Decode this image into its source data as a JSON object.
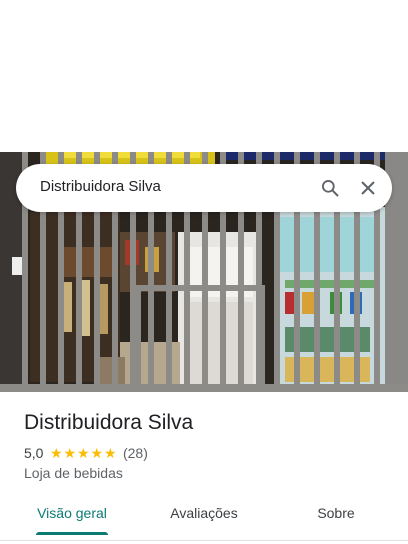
{
  "search": {
    "query": "Distribuidora Silva",
    "search_icon": "search-icon",
    "close_icon": "close-icon"
  },
  "place": {
    "name": "Distribuidora Silva",
    "rating": "5,0",
    "stars": 5,
    "reviews": "(28)",
    "category": "Loja de bebidas"
  },
  "tabs": [
    {
      "label": "Visão geral",
      "active": true
    },
    {
      "label": "Avaliações",
      "active": false
    },
    {
      "label": "Sobre",
      "active": false
    }
  ],
  "colors": {
    "accent": "#0b7a75",
    "star": "#fbbc04",
    "text_primary": "#202124",
    "text_secondary": "#5f6368"
  }
}
